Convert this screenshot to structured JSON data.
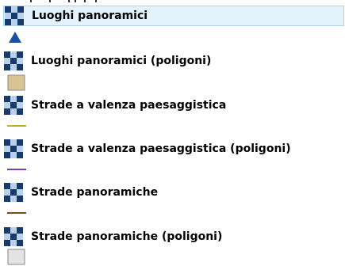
{
  "legend": {
    "layers": [
      {
        "label": "Luoghi panoramici",
        "selected": true,
        "symbol": "triangle",
        "symbol_color": "#1a4fa3"
      },
      {
        "label": "Luoghi panoramici (poligoni)",
        "selected": false,
        "symbol": "polygon-fill",
        "symbol_color": "#d9c393"
      },
      {
        "label": "Strade a valenza paesaggistica",
        "selected": false,
        "symbol": "line",
        "symbol_color": "#b5b623"
      },
      {
        "label": "Strade a valenza paesaggistica (poligoni)",
        "selected": false,
        "symbol": "line",
        "symbol_color": "#7b3fc4"
      },
      {
        "label": "Strade panoramiche",
        "selected": false,
        "symbol": "line",
        "symbol_color": "#7a4a17"
      },
      {
        "label": "Strade panoramiche (poligoni)",
        "selected": false,
        "symbol": "polygon-fill",
        "symbol_color": "#e3e3e3"
      }
    ],
    "layer_icon": "layer-raster-icon"
  }
}
